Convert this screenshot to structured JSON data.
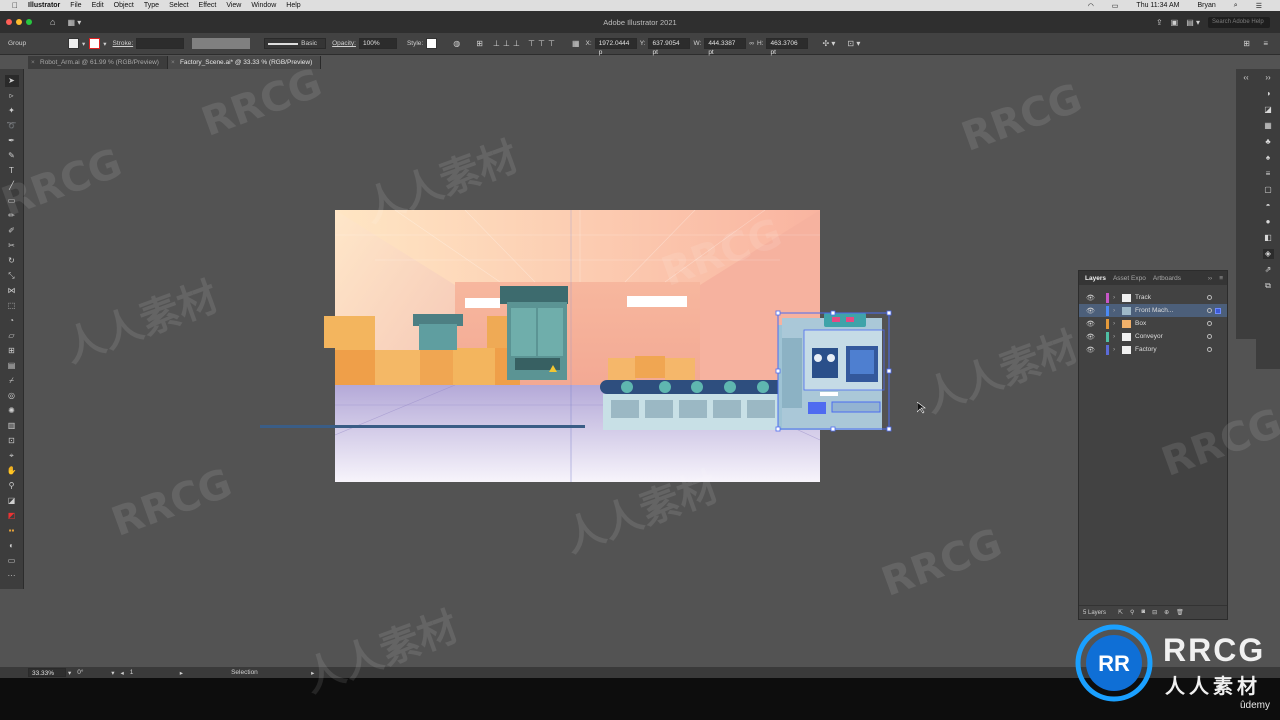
{
  "menubar": {
    "app_name": "Illustrator",
    "items": [
      "File",
      "Edit",
      "Object",
      "Type",
      "Select",
      "Effect",
      "View",
      "Window",
      "Help"
    ],
    "clock": "Thu 11:34 AM",
    "user": "Bryan"
  },
  "titlebar": {
    "title": "Adobe Illustrator 2021",
    "search_placeholder": "Search Adobe Help"
  },
  "controlbar": {
    "selection_type": "Group",
    "stroke_label": "Stroke:",
    "brush_label": "Basic",
    "opacity_label": "Opacity:",
    "opacity_value": "100%",
    "style_label": "Style:",
    "x_label": "X:",
    "x_value": "1972.0444 p",
    "y_label": "Y:",
    "y_value": "637.9054 pt",
    "w_label": "W:",
    "w_value": "444.3387 pt",
    "h_label": "H:",
    "h_value": "463.3706 pt"
  },
  "tabs": [
    {
      "label": "Robot_Arm.ai @ 61.99 % (RGB/Preview)",
      "active": false
    },
    {
      "label": "Factory_Scene.ai* @ 33.33 % (RGB/Preview)",
      "active": true
    }
  ],
  "layers_panel": {
    "tabs": [
      "Layers",
      "Asset Expo",
      "Artboards"
    ],
    "layers": [
      {
        "name": "Track",
        "color": "#c756c7",
        "selected": false
      },
      {
        "name": "Front Mach...",
        "color": "#4b8af5",
        "selected": true
      },
      {
        "name": "Box",
        "color": "#e59a3a",
        "selected": false
      },
      {
        "name": "Conveyor",
        "color": "#4fbfa4",
        "selected": false
      },
      {
        "name": "Factory",
        "color": "#5b6bd8",
        "selected": false
      }
    ],
    "footer_count": "5 Layers"
  },
  "statusbar": {
    "zoom": "33.33%",
    "rotation": "0°",
    "artboard_number": "1",
    "tool_name": "Selection"
  },
  "watermark": {
    "latin": "RRCG",
    "cjk": "人人素材"
  },
  "brand": {
    "logo_text": "RRCG",
    "subtitle": "人人素材",
    "udemy": "ûdemy"
  },
  "colors": {
    "selection_blue": "#4b6cf0",
    "ui_dark": "#424242",
    "canvas_bg": "#535353"
  }
}
